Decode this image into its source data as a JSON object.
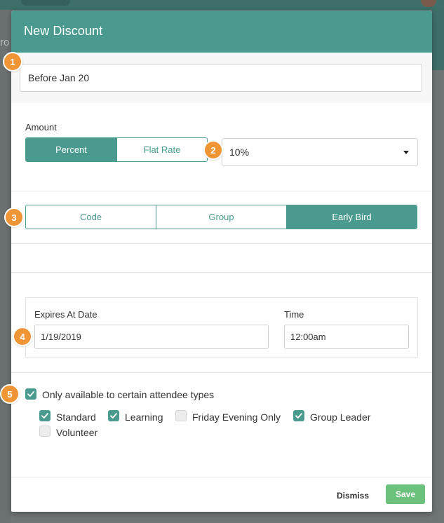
{
  "modal": {
    "title": "New Discount",
    "name_value": "Before Jan 20"
  },
  "amount": {
    "label": "Amount",
    "modes": [
      {
        "label": "Percent",
        "active": true
      },
      {
        "label": "Flat Rate",
        "active": false
      }
    ],
    "selected_value": "10%"
  },
  "discount_types": [
    {
      "label": "Code",
      "active": false
    },
    {
      "label": "Group",
      "active": false
    },
    {
      "label": "Early Bird",
      "active": true
    }
  ],
  "expiry": {
    "date_label": "Expires At Date",
    "date_value": "1/19/2019",
    "time_label": "Time",
    "time_value": "12:00am"
  },
  "attendee_restriction": {
    "label": "Only available to certain attendee types",
    "checked": true,
    "types": [
      {
        "label": "Standard",
        "checked": true
      },
      {
        "label": "Learning",
        "checked": true
      },
      {
        "label": "Friday Evening Only",
        "checked": false
      },
      {
        "label": "Group Leader",
        "checked": true
      },
      {
        "label": "Volunteer",
        "checked": false
      }
    ]
  },
  "footer": {
    "dismiss_label": "Dismiss",
    "save_label": "Save"
  },
  "markers": [
    "1",
    "2",
    "3",
    "4",
    "5"
  ],
  "background": {
    "partial_text": "ro"
  },
  "colors": {
    "primary": "#4a9a8f",
    "save": "#6cc17c",
    "marker": "#ef9535"
  }
}
